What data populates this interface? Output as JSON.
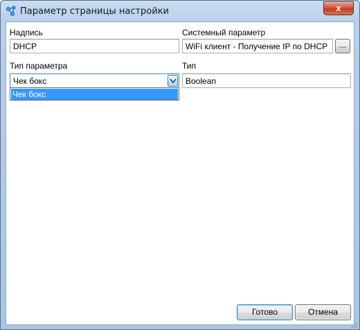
{
  "window": {
    "title": "Параметр страницы настройки",
    "close_glyph": "x"
  },
  "form": {
    "caption_label": "Надпись",
    "caption_value": "DHCP",
    "system_param_label": "Системный параметр",
    "system_param_value": "WiFi клиент - Получение IP по DHCP",
    "browse_label": "...",
    "param_type_label": "Тип параметра",
    "param_type_value": "Чек бокс",
    "param_type_options": [
      "Чек бокс"
    ],
    "type_label": "Тип",
    "type_value": "Boolean"
  },
  "buttons": {
    "ok_label": "Готово",
    "cancel_label": "Отмена"
  },
  "colors": {
    "selection": "#3399ff",
    "title_bar": "#b8d0ea",
    "close_button": "#c0392b"
  },
  "icons": {
    "app": "network-nodes-icon",
    "dropdown": "chevron-down-icon",
    "resize": "resize-grip-icon"
  }
}
